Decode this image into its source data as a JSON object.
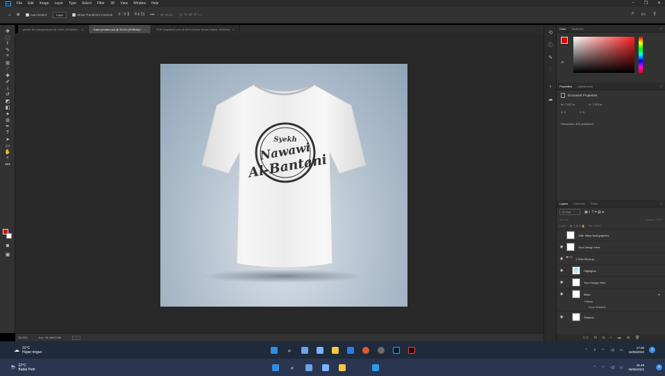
{
  "menu": [
    "File",
    "Edit",
    "Image",
    "Layer",
    "Type",
    "Select",
    "Filter",
    "3D",
    "View",
    "Window",
    "Help"
  ],
  "options": {
    "auto_select": "Auto-Select:",
    "layer_dropdown": "Layer",
    "show_transform": "Show Transform Controls",
    "mode3d": "3D Mode:"
  },
  "doc_tabs": [
    {
      "label": "pecker 80_lokoyeda.psd @ 100% (RGB/8#) *",
      "active": false
    },
    {
      "label": "Kaos pendek.psd @ 33,3% (RGB/8#) *",
      "active": true
    },
    {
      "label": "PSD Graphics1.psb @ 50% (Vector Smart Object, RGB/8#)",
      "active": false
    }
  ],
  "tshirt_text": {
    "line1": "Syekh",
    "line2": "Nawawi",
    "line3": "Al-Bantani"
  },
  "status": {
    "zoom": "33,33%",
    "doc": "Doc: 16,4M/93,0M"
  },
  "color_panel": {
    "tabs": [
      "Color",
      "Swatches"
    ],
    "fg": "#e00000",
    "bg": "#ffffff"
  },
  "properties": {
    "tabs": [
      "Properties",
      "Adjustments"
    ],
    "title": "Document Properties",
    "w": "W: 7,627 in",
    "h": "H: 7,323 in",
    "x": "X: 0",
    "y": "Y: 0",
    "resolution": "Resolution: 300 pixels/inch"
  },
  "layers": {
    "tabs": [
      "Layers",
      "Channels",
      "Paths"
    ],
    "kind": "Q Kind",
    "blend": "Normal",
    "opacity": "Opacity: 100%",
    "lock": "Lock:",
    "fill": "Fill: 100%",
    "items": [
      {
        "name": "Visit: https://psd.graphics",
        "thumb": "white",
        "visible": false
      },
      {
        "name": "Your Design Here",
        "thumb": "white",
        "visible": true
      },
      {
        "name": "T-Shirt Mockup",
        "thumb": "folder",
        "visible": true
      },
      {
        "name": "Highlights",
        "thumb": "tshirt",
        "visible": true
      },
      {
        "name": "Your Design Here",
        "thumb": "white",
        "visible": true
      },
      {
        "name": "Basic",
        "thumb": "white",
        "visible": true,
        "fx": "fx"
      },
      {
        "name": "Shadow",
        "thumb": "white",
        "visible": true
      }
    ],
    "effects": "Effects",
    "drop_shadow": "Drop Shadow"
  },
  "taskbar_top": {
    "temp": "31°C",
    "condition": "Hujan ringan",
    "time": "17.00",
    "date": "16/05/2022"
  },
  "taskbar_bottom": {
    "temp": "22°C",
    "condition": "Badai Petir",
    "time": "15.48",
    "date": "06/06/2022"
  },
  "colors": {
    "accent": "#31a8ff",
    "ps_bg": "#282828",
    "panel": "#323232"
  }
}
